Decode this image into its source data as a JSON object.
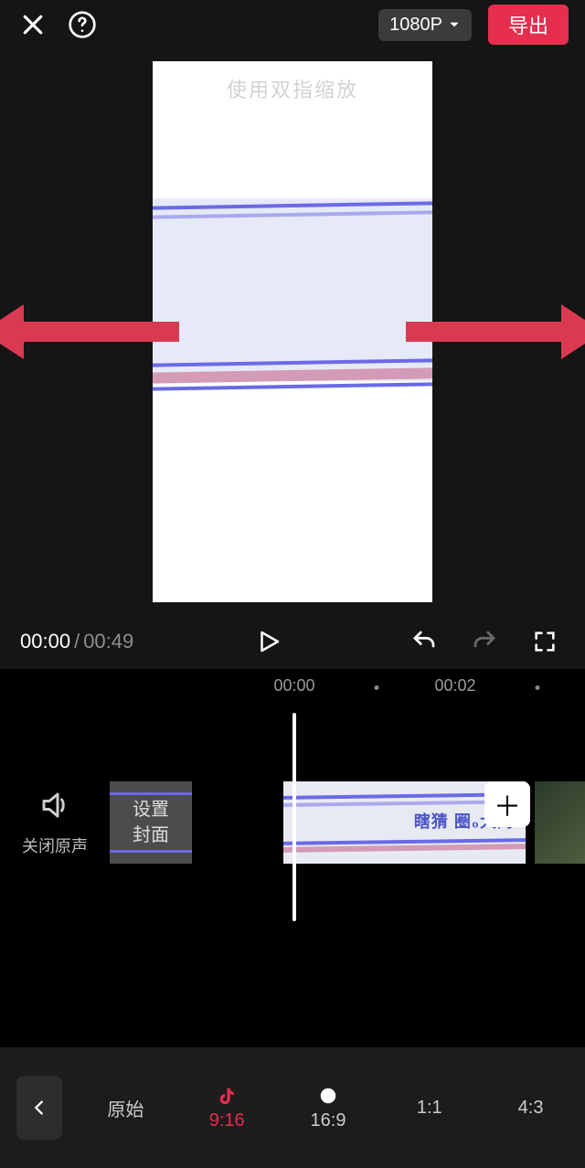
{
  "header": {
    "resolution_label": "1080P",
    "export_label": "导出"
  },
  "preview": {
    "hint_text": "使用双指缩放"
  },
  "playback": {
    "current_time": "00:00",
    "total_time": "00:49"
  },
  "timeline": {
    "tick_a": "00:00",
    "tick_b": "00:02",
    "mute_label": "关闭原声",
    "cover_btn_line1": "设置",
    "cover_btn_line2": "封面",
    "clip_overlay_text": "瞎猜 圈₀大的"
  },
  "aspect_ratios": {
    "original": "原始",
    "r916": "9:16",
    "r169": "16:9",
    "r11": "1:1",
    "r43": "4:3"
  }
}
